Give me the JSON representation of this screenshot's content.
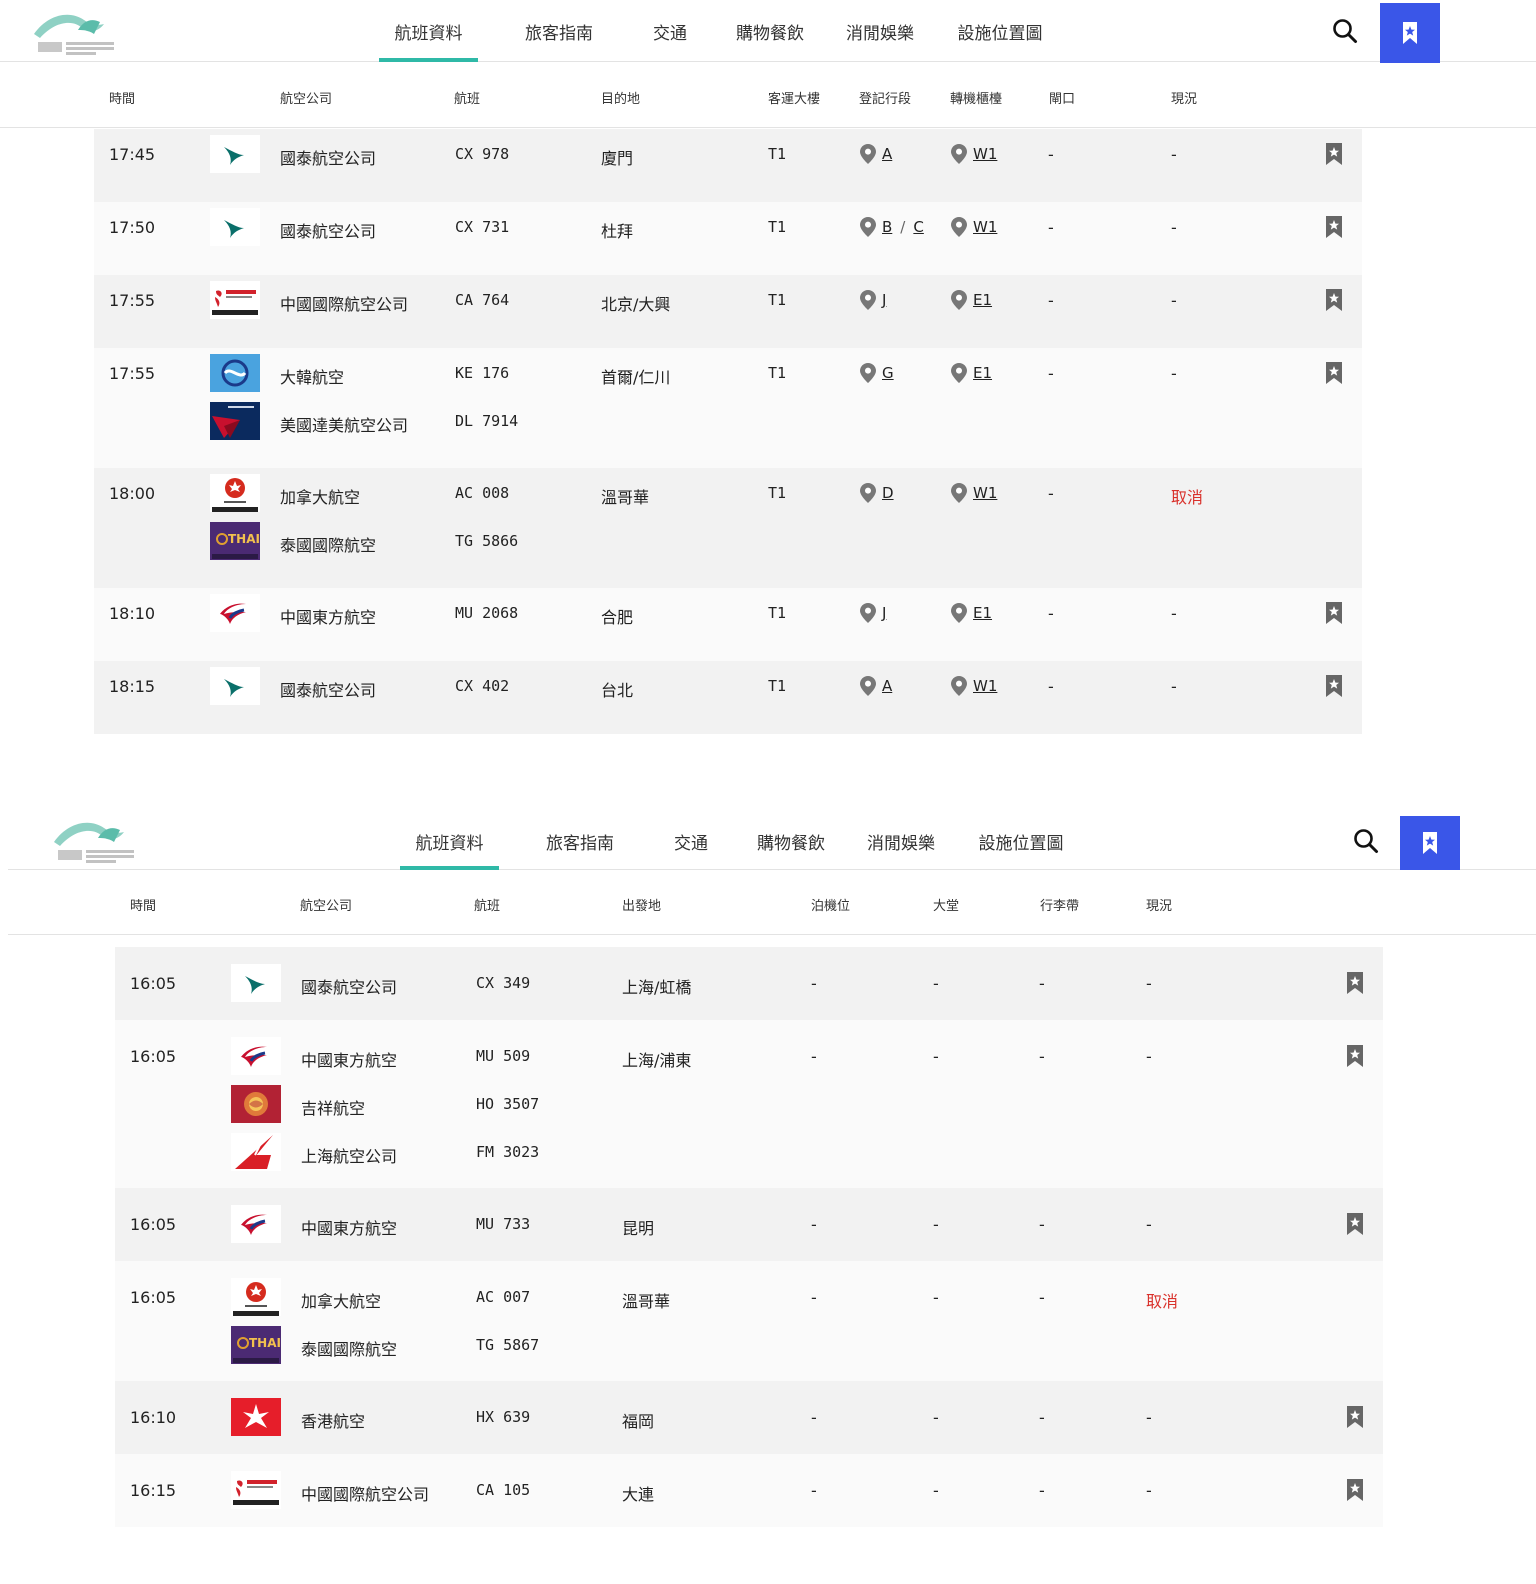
{
  "nav": {
    "items": [
      "航班資料",
      "旅客指南",
      "交通",
      "購物餐飲",
      "消閒娛樂",
      "設施位置圖"
    ]
  },
  "colors": {
    "accent": "#2fb9a7",
    "bookmark_bg": "#3a56e8",
    "cancel": "#d9312b"
  },
  "departures": {
    "headers": {
      "time": "時間",
      "airline": "航空公司",
      "flight": "航班",
      "dest": "目的地",
      "terminal": "客運大樓",
      "checkin": "登記行段",
      "transfer": "轉機櫃檯",
      "gate": "閘口",
      "status": "現況"
    },
    "rows": [
      {
        "time": "17:45",
        "flights": [
          {
            "logo": "cathay",
            "airline": "國泰航空公司",
            "code": "CX 978"
          }
        ],
        "dest": "廈門",
        "terminal": "T1",
        "checkin": [
          "A"
        ],
        "transfer": "W1",
        "gate": "-",
        "status": "-",
        "bookmark": true
      },
      {
        "time": "17:50",
        "flights": [
          {
            "logo": "cathay",
            "airline": "國泰航空公司",
            "code": "CX 731"
          }
        ],
        "dest": "杜拜",
        "terminal": "T1",
        "checkin": [
          "B",
          "C"
        ],
        "checkin_sep": "/",
        "transfer": "W1",
        "gate": "-",
        "status": "-",
        "bookmark": true
      },
      {
        "time": "17:55",
        "flights": [
          {
            "logo": "airchina",
            "airline": "中國國際航空公司",
            "code": "CA 764"
          }
        ],
        "dest": "北京/大興",
        "terminal": "T1",
        "checkin": [
          "J"
        ],
        "transfer": "E1",
        "gate": "-",
        "status": "-",
        "bookmark": true
      },
      {
        "time": "17:55",
        "flights": [
          {
            "logo": "koreanair",
            "airline": "大韓航空",
            "code": "KE 176"
          },
          {
            "logo": "delta",
            "airline": "美國達美航空公司",
            "code": "DL 7914"
          }
        ],
        "dest": "首爾/仁川",
        "terminal": "T1",
        "checkin": [
          "G"
        ],
        "transfer": "E1",
        "gate": "-",
        "status": "-",
        "bookmark": true
      },
      {
        "time": "18:00",
        "flights": [
          {
            "logo": "aircanada",
            "airline": "加拿大航空",
            "code": "AC 008"
          },
          {
            "logo": "thai",
            "airline": "泰國國際航空",
            "code": "TG 5866"
          }
        ],
        "dest": "溫哥華",
        "terminal": "T1",
        "checkin": [
          "D"
        ],
        "transfer": "W1",
        "gate": "-",
        "status": "取消",
        "cancelled": true,
        "bookmark": false
      },
      {
        "time": "18:10",
        "flights": [
          {
            "logo": "chinaeastern",
            "airline": "中國東方航空",
            "code": "MU 2068"
          }
        ],
        "dest": "合肥",
        "terminal": "T1",
        "checkin": [
          "J"
        ],
        "transfer": "E1",
        "gate": "-",
        "status": "-",
        "bookmark": true
      },
      {
        "time": "18:15",
        "flights": [
          {
            "logo": "cathay",
            "airline": "國泰航空公司",
            "code": "CX 402"
          }
        ],
        "dest": "台北",
        "terminal": "T1",
        "checkin": [
          "A"
        ],
        "transfer": "W1",
        "gate": "-",
        "status": "-",
        "bookmark": true
      }
    ]
  },
  "arrivals": {
    "headers": {
      "time": "時間",
      "airline": "航空公司",
      "flight": "航班",
      "origin": "出發地",
      "stand": "泊機位",
      "hall": "大堂",
      "belt": "行李帶",
      "status": "現況"
    },
    "rows": [
      {
        "time": "16:05",
        "flights": [
          {
            "logo": "cathay",
            "airline": "國泰航空公司",
            "code": "CX 349"
          }
        ],
        "origin": "上海/虹橋",
        "stand": "-",
        "hall": "-",
        "belt": "-",
        "status": "-",
        "bookmark": true
      },
      {
        "time": "16:05",
        "flights": [
          {
            "logo": "chinaeastern",
            "airline": "中國東方航空",
            "code": "MU 509"
          },
          {
            "logo": "juneyao",
            "airline": "吉祥航空",
            "code": "HO 3507"
          },
          {
            "logo": "shanghai",
            "airline": "上海航空公司",
            "code": "FM 3023"
          }
        ],
        "origin": "上海/浦東",
        "stand": "-",
        "hall": "-",
        "belt": "-",
        "status": "-",
        "bookmark": true
      },
      {
        "time": "16:05",
        "flights": [
          {
            "logo": "chinaeastern",
            "airline": "中國東方航空",
            "code": "MU 733"
          }
        ],
        "origin": "昆明",
        "stand": "-",
        "hall": "-",
        "belt": "-",
        "status": "-",
        "bookmark": true
      },
      {
        "time": "16:05",
        "flights": [
          {
            "logo": "aircanada",
            "airline": "加拿大航空",
            "code": "AC 007"
          },
          {
            "logo": "thai",
            "airline": "泰國國際航空",
            "code": "TG 5867"
          }
        ],
        "origin": "溫哥華",
        "stand": "-",
        "hall": "-",
        "belt": "-",
        "status": "取消",
        "cancelled": true,
        "bookmark": false
      },
      {
        "time": "16:10",
        "flights": [
          {
            "logo": "hkairlines",
            "airline": "香港航空",
            "code": "HX 639"
          }
        ],
        "origin": "福岡",
        "stand": "-",
        "hall": "-",
        "belt": "-",
        "status": "-",
        "bookmark": true
      },
      {
        "time": "16:15",
        "flights": [
          {
            "logo": "airchina",
            "airline": "中國國際航空公司",
            "code": "CA 105"
          }
        ],
        "origin": "大連",
        "stand": "-",
        "hall": "-",
        "belt": "-",
        "status": "-",
        "bookmark": true
      }
    ]
  }
}
